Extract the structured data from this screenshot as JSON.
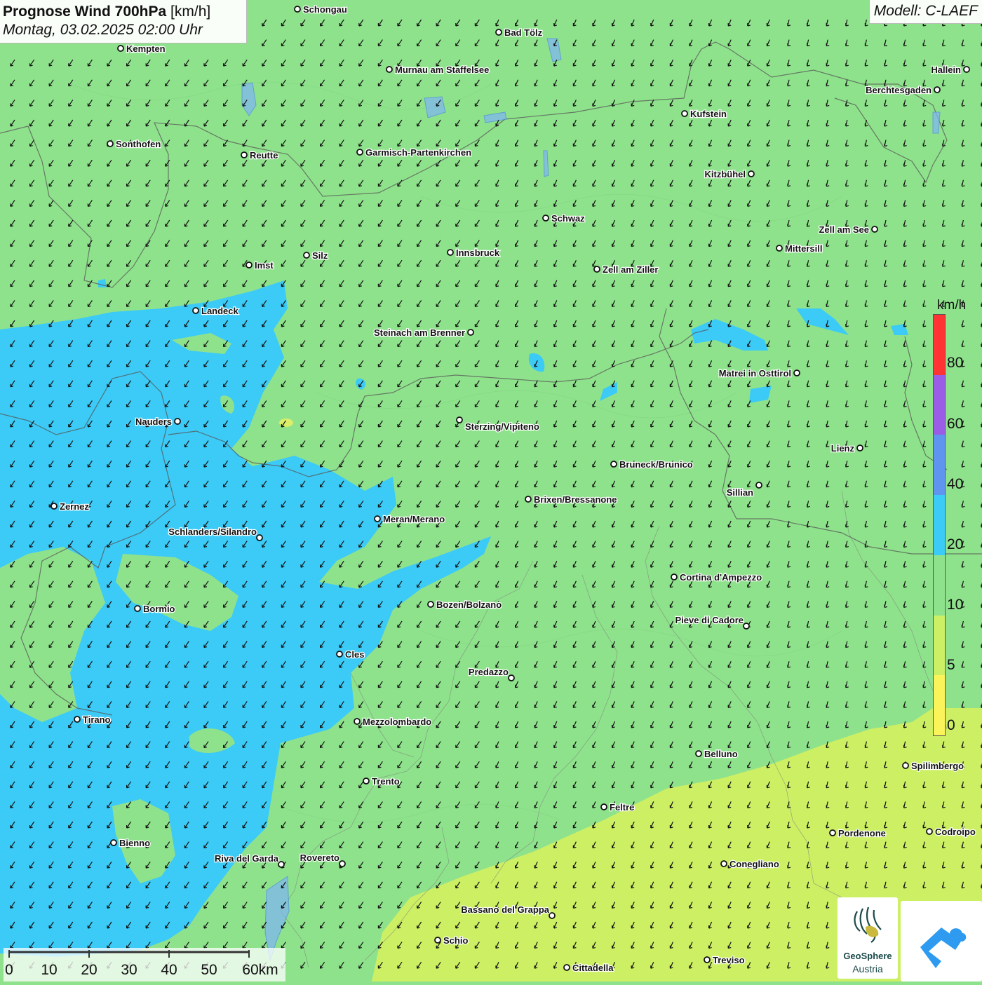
{
  "title": {
    "main": "Prognose Wind 700hPa",
    "unit": "[km/h]",
    "datetime": "Montag, 03.02.2025 02:00 Uhr"
  },
  "model": "Modell: C-LAEF",
  "legend": {
    "unit": "km/h",
    "labels": [
      "80",
      "60",
      "40",
      "20",
      "10",
      "5",
      "0"
    ],
    "colors": [
      "#ff3333",
      "#9b5de6",
      "#5f95ef",
      "#3ccaf6",
      "#8fe28c",
      "#cdef64",
      "#fbf35a"
    ]
  },
  "scale_bar": {
    "labels": [
      "0",
      "10",
      "20",
      "30",
      "40",
      "50",
      "60km"
    ]
  },
  "logos": {
    "geosphere_name": "GeoSphere",
    "geosphere_sub": "Austria"
  },
  "cities": [
    {
      "name": "Schongau"
    },
    {
      "name": "Bad Tölz"
    },
    {
      "name": "Kempten"
    },
    {
      "name": "Hallein"
    },
    {
      "name": "Murnau am Staffelsee"
    },
    {
      "name": "Berchtesgaden"
    },
    {
      "name": "Kufstein"
    },
    {
      "name": "Sonthofen"
    },
    {
      "name": "Reutte"
    },
    {
      "name": "Garmisch-Partenkirchen"
    },
    {
      "name": "Kitzbühel"
    },
    {
      "name": "Schwaz"
    },
    {
      "name": "Zell am See"
    },
    {
      "name": "Mittersill"
    },
    {
      "name": "Innsbruck"
    },
    {
      "name": "Silz"
    },
    {
      "name": "Imst"
    },
    {
      "name": "Zell am Ziller"
    },
    {
      "name": "Landeck"
    },
    {
      "name": "Steinach am Brenner"
    },
    {
      "name": "Matrei in Osttirol"
    },
    {
      "name": "Nauders"
    },
    {
      "name": "Sterzing/Vipiteno"
    },
    {
      "name": "Lienz"
    },
    {
      "name": "Bruneck/Brunico"
    },
    {
      "name": "Sillian"
    },
    {
      "name": "Brixen/Bressanone"
    },
    {
      "name": "Zernez"
    },
    {
      "name": "Meran/Merano"
    },
    {
      "name": "Schlanders/Silandro"
    },
    {
      "name": "Cortina d'Ampezzo"
    },
    {
      "name": "Bozen/Bolzano"
    },
    {
      "name": "Bormio"
    },
    {
      "name": "Pieve di Cadore"
    },
    {
      "name": "Cles"
    },
    {
      "name": "Predazzo"
    },
    {
      "name": "Tirano"
    },
    {
      "name": "Mezzolombardo"
    },
    {
      "name": "Belluno"
    },
    {
      "name": "Spilimbergo"
    },
    {
      "name": "Trento"
    },
    {
      "name": "Feltre"
    },
    {
      "name": "Pordenone"
    },
    {
      "name": "Codroipo"
    },
    {
      "name": "Bienno"
    },
    {
      "name": "Riva del Garda"
    },
    {
      "name": "Rovereto"
    },
    {
      "name": "Conegliano"
    },
    {
      "name": "Bassano del Grappa"
    },
    {
      "name": "Schio"
    },
    {
      "name": "Treviso"
    },
    {
      "name": "Cittadella"
    }
  ]
}
